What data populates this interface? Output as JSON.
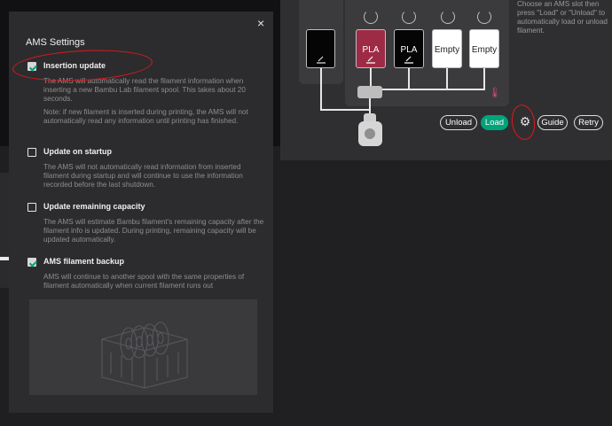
{
  "background": {
    "help_text": "Choose an AMS slot then press \"Load\" or \"Unload\" to automatically load or unload filament.",
    "ams_slots": [
      {
        "label": "PLA",
        "color": "#9e2b45"
      },
      {
        "label": "PLA",
        "color": "#050505"
      },
      {
        "label": "Empty",
        "color": "#ffffff"
      },
      {
        "label": "Empty",
        "color": "#ffffff"
      }
    ],
    "buttons": {
      "unload": "Unload",
      "load": "Load",
      "guide": "Guide",
      "retry": "Retry"
    },
    "accent_color": "#00a37a",
    "annotation_color": "#e3171c"
  },
  "dialog": {
    "close": "×",
    "title": "AMS Settings",
    "options": [
      {
        "label": "Insertion update",
        "checked": true,
        "description": "The AMS will automatically read the filament information when inserting a new Bambu Lab filament spool. This takes about 20 seconds.",
        "note": "Note: if new filament is inserted during  printing, the AMS will not automatically read any information until printing has finished."
      },
      {
        "label": "Update on startup",
        "checked": false,
        "description": "The AMS will not automatically read information from inserted filament during startup and will continue to use the information recorded before the last shutdown."
      },
      {
        "label": "Update remaining capacity",
        "checked": false,
        "description": "The AMS will estimate Bambu filament's remaining capacity after the filament info is updated. During printing, remaining capacity will be updated automatically."
      },
      {
        "label": "AMS filament backup",
        "checked": true,
        "description": "AMS will continue to another spool with the same properties of filament automatically when current filament runs out"
      }
    ]
  }
}
